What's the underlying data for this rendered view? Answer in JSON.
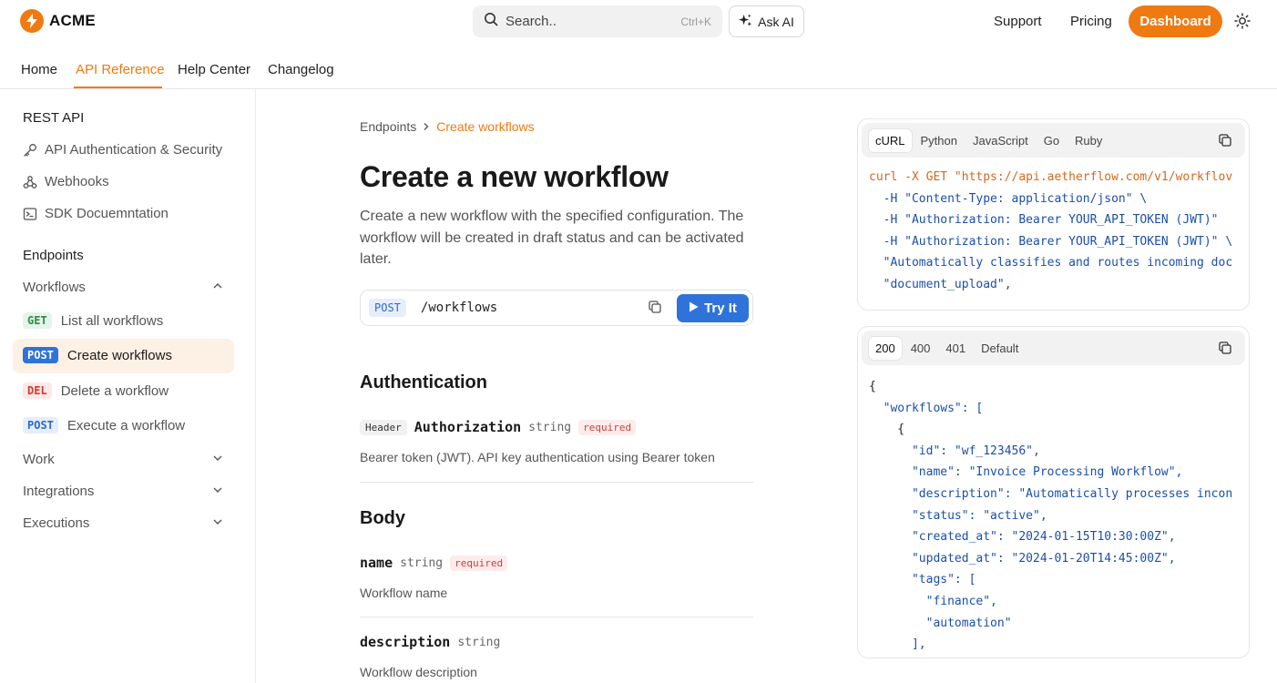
{
  "brand": {
    "name": "ACME",
    "accent": "#f07a12"
  },
  "header": {
    "search_placeholder": "Search..",
    "search_shortcut": "Ctrl+K",
    "ask_ai": "Ask AI",
    "links": {
      "support": "Support",
      "pricing": "Pricing"
    },
    "dashboard": "Dashboard"
  },
  "nav": {
    "tabs": [
      {
        "label": "Home"
      },
      {
        "label": "API Reference",
        "active": true
      },
      {
        "label": "Help Center"
      },
      {
        "label": "Changelog"
      }
    ]
  },
  "sidebar": {
    "rest_api": {
      "title": "REST API",
      "items": [
        {
          "label": "API Authentication & Security",
          "icon": "key-icon"
        },
        {
          "label": "Webhooks",
          "icon": "webhook-icon"
        },
        {
          "label": "SDK Docuemntation",
          "icon": "terminal-icon"
        }
      ]
    },
    "endpoints": {
      "title": "Endpoints",
      "groups": {
        "workflows": "Workflows",
        "work": "Work",
        "integrations": "Integrations",
        "executions": "Executions"
      },
      "items": [
        {
          "method": "GET",
          "label": "List all workflows"
        },
        {
          "method": "POST",
          "label": "Create workflows",
          "active": true
        },
        {
          "method": "DEL",
          "label": "Delete a workflow"
        },
        {
          "method": "POST",
          "label": "Execute a workflow"
        }
      ]
    }
  },
  "main": {
    "breadcrumb": {
      "parent": "Endpoints",
      "current": "Create workflows"
    },
    "title": "Create a new workflow",
    "description": "Create a new workflow with the specified configuration. The workflow will be created in draft status and can be activated later.",
    "endpoint": {
      "method": "POST",
      "path": "/workflows",
      "try_label": "Try It"
    },
    "authentication": {
      "heading": "Authentication",
      "param": {
        "location": "Header",
        "name": "Authorization",
        "type": "string",
        "required": "required"
      },
      "description": "Bearer token (JWT). API key authentication using Bearer token"
    },
    "body": {
      "heading": "Body",
      "params": [
        {
          "name": "name",
          "type": "string",
          "required": "required",
          "description": "Workflow name"
        },
        {
          "name": "description",
          "type": "string",
          "required": "",
          "description": "Workflow description"
        }
      ]
    }
  },
  "request_panel": {
    "tabs": [
      "cURL",
      "Python",
      "JavaScript",
      "Go",
      "Ruby"
    ],
    "active_tab": "cURL",
    "lines": [
      "curl -X GET \"https://api.aetherflow.com/v1/workflov",
      "  -H \"Content-Type: application/json\" \\",
      "  -H \"Authorization: Bearer YOUR_API_TOKEN (JWT)\"",
      "  -H \"Authorization: Bearer YOUR_API_TOKEN (JWT)\" \\",
      "  \"Automatically classifies and routes incoming doc",
      "  \"document_upload\","
    ]
  },
  "response_panel": {
    "tabs": [
      "200",
      "400",
      "401",
      "Default"
    ],
    "active_tab": "200",
    "lines": [
      "{",
      "  \"workflows\": [",
      "    {",
      "      \"id\": \"wf_123456\",",
      "      \"name\": \"Invoice Processing Workflow\",",
      "      \"description\": \"Automatically processes incon",
      "      \"status\": \"active\",",
      "      \"created_at\": \"2024-01-15T10:30:00Z\",",
      "      \"updated_at\": \"2024-01-20T14:45:00Z\",",
      "      \"tags\": [",
      "        \"finance\",",
      "        \"automation\"",
      "      ],"
    ]
  }
}
